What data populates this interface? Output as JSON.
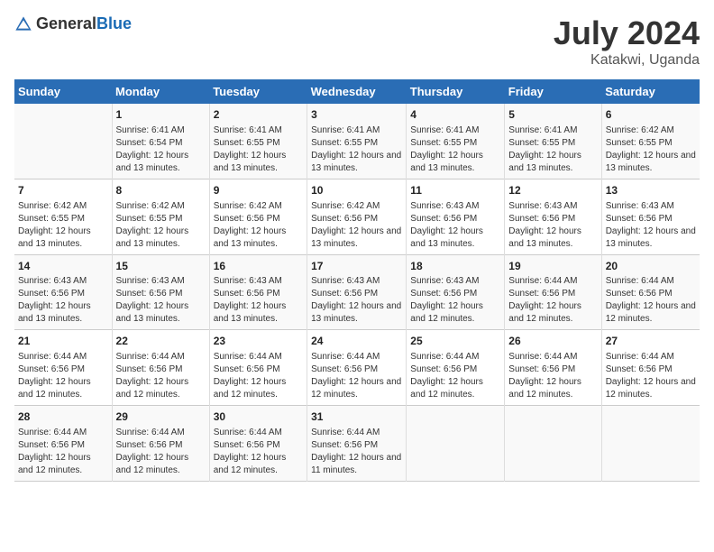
{
  "header": {
    "logo_general": "General",
    "logo_blue": "Blue",
    "title": "July 2024",
    "subtitle": "Katakwi, Uganda"
  },
  "days_of_week": [
    "Sunday",
    "Monday",
    "Tuesday",
    "Wednesday",
    "Thursday",
    "Friday",
    "Saturday"
  ],
  "weeks": [
    [
      {
        "day": "",
        "sunrise": "",
        "sunset": "",
        "daylight": ""
      },
      {
        "day": "1",
        "sunrise": "Sunrise: 6:41 AM",
        "sunset": "Sunset: 6:54 PM",
        "daylight": "Daylight: 12 hours and 13 minutes."
      },
      {
        "day": "2",
        "sunrise": "Sunrise: 6:41 AM",
        "sunset": "Sunset: 6:55 PM",
        "daylight": "Daylight: 12 hours and 13 minutes."
      },
      {
        "day": "3",
        "sunrise": "Sunrise: 6:41 AM",
        "sunset": "Sunset: 6:55 PM",
        "daylight": "Daylight: 12 hours and 13 minutes."
      },
      {
        "day": "4",
        "sunrise": "Sunrise: 6:41 AM",
        "sunset": "Sunset: 6:55 PM",
        "daylight": "Daylight: 12 hours and 13 minutes."
      },
      {
        "day": "5",
        "sunrise": "Sunrise: 6:41 AM",
        "sunset": "Sunset: 6:55 PM",
        "daylight": "Daylight: 12 hours and 13 minutes."
      },
      {
        "day": "6",
        "sunrise": "Sunrise: 6:42 AM",
        "sunset": "Sunset: 6:55 PM",
        "daylight": "Daylight: 12 hours and 13 minutes."
      }
    ],
    [
      {
        "day": "7",
        "sunrise": "Sunrise: 6:42 AM",
        "sunset": "Sunset: 6:55 PM",
        "daylight": "Daylight: 12 hours and 13 minutes."
      },
      {
        "day": "8",
        "sunrise": "Sunrise: 6:42 AM",
        "sunset": "Sunset: 6:55 PM",
        "daylight": "Daylight: 12 hours and 13 minutes."
      },
      {
        "day": "9",
        "sunrise": "Sunrise: 6:42 AM",
        "sunset": "Sunset: 6:56 PM",
        "daylight": "Daylight: 12 hours and 13 minutes."
      },
      {
        "day": "10",
        "sunrise": "Sunrise: 6:42 AM",
        "sunset": "Sunset: 6:56 PM",
        "daylight": "Daylight: 12 hours and 13 minutes."
      },
      {
        "day": "11",
        "sunrise": "Sunrise: 6:43 AM",
        "sunset": "Sunset: 6:56 PM",
        "daylight": "Daylight: 12 hours and 13 minutes."
      },
      {
        "day": "12",
        "sunrise": "Sunrise: 6:43 AM",
        "sunset": "Sunset: 6:56 PM",
        "daylight": "Daylight: 12 hours and 13 minutes."
      },
      {
        "day": "13",
        "sunrise": "Sunrise: 6:43 AM",
        "sunset": "Sunset: 6:56 PM",
        "daylight": "Daylight: 12 hours and 13 minutes."
      }
    ],
    [
      {
        "day": "14",
        "sunrise": "Sunrise: 6:43 AM",
        "sunset": "Sunset: 6:56 PM",
        "daylight": "Daylight: 12 hours and 13 minutes."
      },
      {
        "day": "15",
        "sunrise": "Sunrise: 6:43 AM",
        "sunset": "Sunset: 6:56 PM",
        "daylight": "Daylight: 12 hours and 13 minutes."
      },
      {
        "day": "16",
        "sunrise": "Sunrise: 6:43 AM",
        "sunset": "Sunset: 6:56 PM",
        "daylight": "Daylight: 12 hours and 13 minutes."
      },
      {
        "day": "17",
        "sunrise": "Sunrise: 6:43 AM",
        "sunset": "Sunset: 6:56 PM",
        "daylight": "Daylight: 12 hours and 13 minutes."
      },
      {
        "day": "18",
        "sunrise": "Sunrise: 6:43 AM",
        "sunset": "Sunset: 6:56 PM",
        "daylight": "Daylight: 12 hours and 12 minutes."
      },
      {
        "day": "19",
        "sunrise": "Sunrise: 6:44 AM",
        "sunset": "Sunset: 6:56 PM",
        "daylight": "Daylight: 12 hours and 12 minutes."
      },
      {
        "day": "20",
        "sunrise": "Sunrise: 6:44 AM",
        "sunset": "Sunset: 6:56 PM",
        "daylight": "Daylight: 12 hours and 12 minutes."
      }
    ],
    [
      {
        "day": "21",
        "sunrise": "Sunrise: 6:44 AM",
        "sunset": "Sunset: 6:56 PM",
        "daylight": "Daylight: 12 hours and 12 minutes."
      },
      {
        "day": "22",
        "sunrise": "Sunrise: 6:44 AM",
        "sunset": "Sunset: 6:56 PM",
        "daylight": "Daylight: 12 hours and 12 minutes."
      },
      {
        "day": "23",
        "sunrise": "Sunrise: 6:44 AM",
        "sunset": "Sunset: 6:56 PM",
        "daylight": "Daylight: 12 hours and 12 minutes."
      },
      {
        "day": "24",
        "sunrise": "Sunrise: 6:44 AM",
        "sunset": "Sunset: 6:56 PM",
        "daylight": "Daylight: 12 hours and 12 minutes."
      },
      {
        "day": "25",
        "sunrise": "Sunrise: 6:44 AM",
        "sunset": "Sunset: 6:56 PM",
        "daylight": "Daylight: 12 hours and 12 minutes."
      },
      {
        "day": "26",
        "sunrise": "Sunrise: 6:44 AM",
        "sunset": "Sunset: 6:56 PM",
        "daylight": "Daylight: 12 hours and 12 minutes."
      },
      {
        "day": "27",
        "sunrise": "Sunrise: 6:44 AM",
        "sunset": "Sunset: 6:56 PM",
        "daylight": "Daylight: 12 hours and 12 minutes."
      }
    ],
    [
      {
        "day": "28",
        "sunrise": "Sunrise: 6:44 AM",
        "sunset": "Sunset: 6:56 PM",
        "daylight": "Daylight: 12 hours and 12 minutes."
      },
      {
        "day": "29",
        "sunrise": "Sunrise: 6:44 AM",
        "sunset": "Sunset: 6:56 PM",
        "daylight": "Daylight: 12 hours and 12 minutes."
      },
      {
        "day": "30",
        "sunrise": "Sunrise: 6:44 AM",
        "sunset": "Sunset: 6:56 PM",
        "daylight": "Daylight: 12 hours and 12 minutes."
      },
      {
        "day": "31",
        "sunrise": "Sunrise: 6:44 AM",
        "sunset": "Sunset: 6:56 PM",
        "daylight": "Daylight: 12 hours and 11 minutes."
      },
      {
        "day": "",
        "sunrise": "",
        "sunset": "",
        "daylight": ""
      },
      {
        "day": "",
        "sunrise": "",
        "sunset": "",
        "daylight": ""
      },
      {
        "day": "",
        "sunrise": "",
        "sunset": "",
        "daylight": ""
      }
    ]
  ]
}
